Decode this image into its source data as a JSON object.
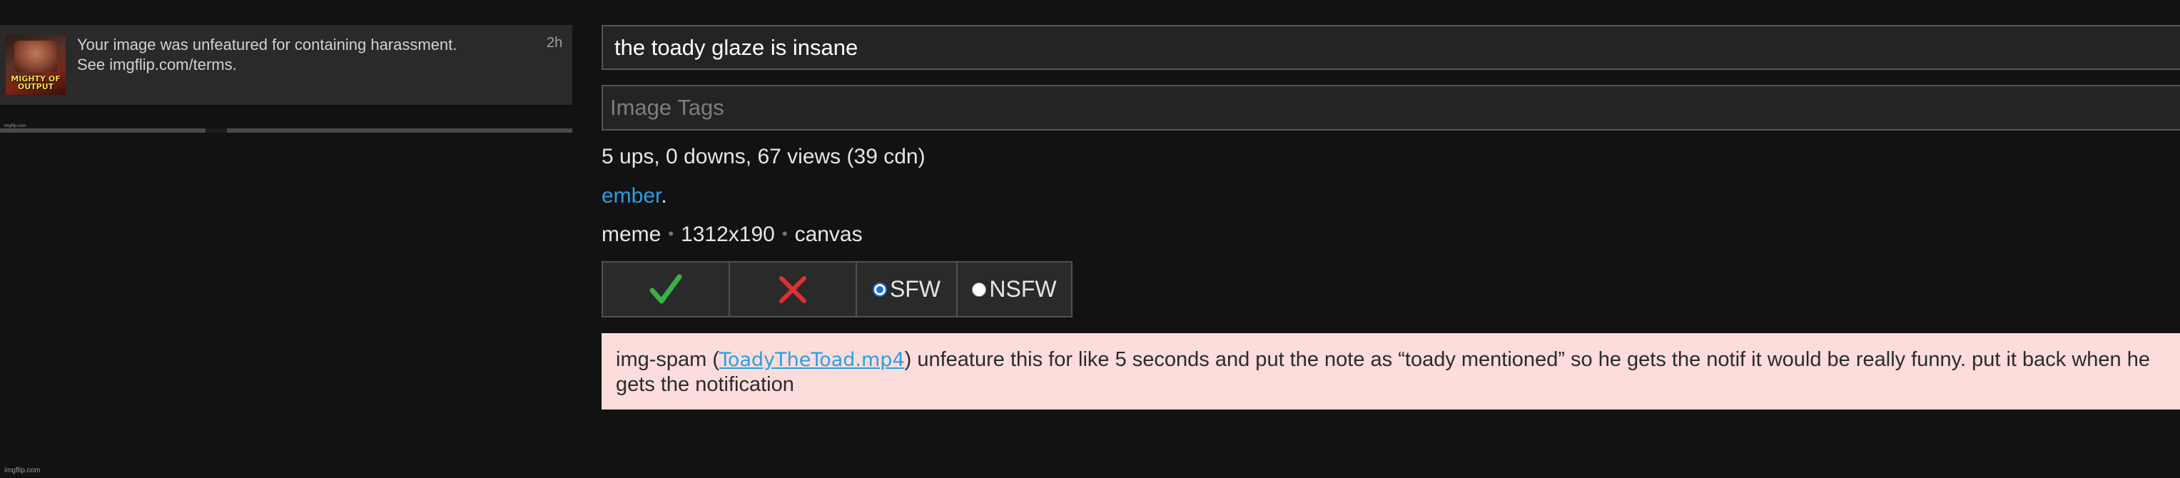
{
  "notification": {
    "thumbnail_caption": "MIGHTY OF OUTPUT",
    "thumbnail_watermark": "imgflip.com",
    "message_line1": "Your image was unfeatured for containing harassment.",
    "message_line2": "See imgflip.com/terms.",
    "time": "2h"
  },
  "editor": {
    "title_value": "the toady glaze is insane",
    "tags_placeholder": "Image Tags",
    "stats": "5 ups, 0 downs, 67 views (39 cdn)",
    "username": "ember",
    "username_suffix": ".",
    "meta": {
      "kind": "meme",
      "dimensions": "1312x190",
      "source": "canvas"
    },
    "controls": {
      "approve_icon": "check-icon",
      "reject_icon": "x-icon",
      "sfw_label": "SFW",
      "nsfw_label": "NSFW",
      "selected": "SFW"
    },
    "note": {
      "prefix": "img-spam (",
      "link": "ToadyTheToad.mp4",
      "body": ") unfeature this for like 5 seconds and put the note as “toady mentioned” so he gets the notif it would be really funny. put it back when he gets the notification"
    }
  },
  "footer": {
    "watermark": "imgflip.com"
  },
  "colors": {
    "background": "#121212",
    "accent_link": "#2a9fe3",
    "approve": "#3cb043",
    "reject": "#e03131",
    "note_bg": "#fddcdc"
  }
}
